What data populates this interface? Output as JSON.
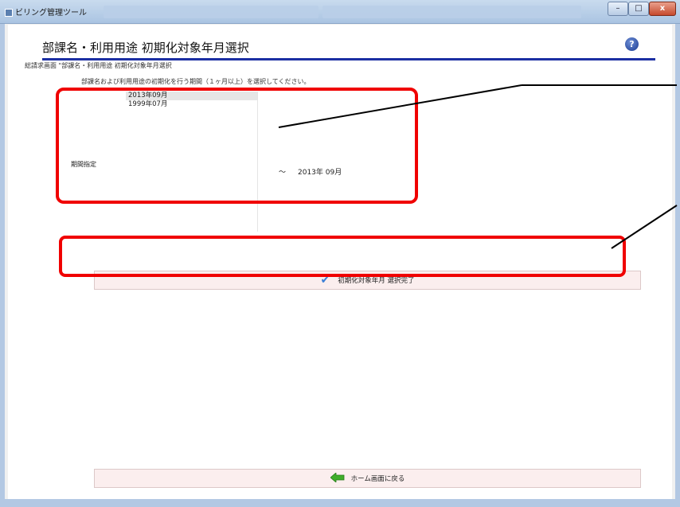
{
  "window": {
    "title": "ビリング管理ツール",
    "minimize_glyph": "–",
    "maximize_glyph": "□",
    "close_glyph": "x"
  },
  "page": {
    "title": "部課名・利用用途 初期化対象年月選択",
    "help_glyph": "?",
    "breadcrumb": "総請求画面 \"部課名・利用用途 初期化対象年月選択",
    "instruction": "部課名および利用用途の初期化を行う期間（１ヶ月以上）を選択してください。"
  },
  "period": {
    "label": "期間指定",
    "months": [
      "2013年09月",
      "1999年07月"
    ],
    "selected_index": 0,
    "tilde": "～",
    "end_value": "2013年 09月"
  },
  "buttons": {
    "confirm_label": "初期化対象年月 選択完了",
    "home_label": "ホーム画面に戻る"
  },
  "icons": {
    "help": "help-icon",
    "confirm": "checkmark-icon",
    "home": "left-arrow-icon"
  },
  "colors": {
    "highlight": "#f00000",
    "title_rule": "#1c2fa3",
    "button_bg": "#fbeeee"
  }
}
